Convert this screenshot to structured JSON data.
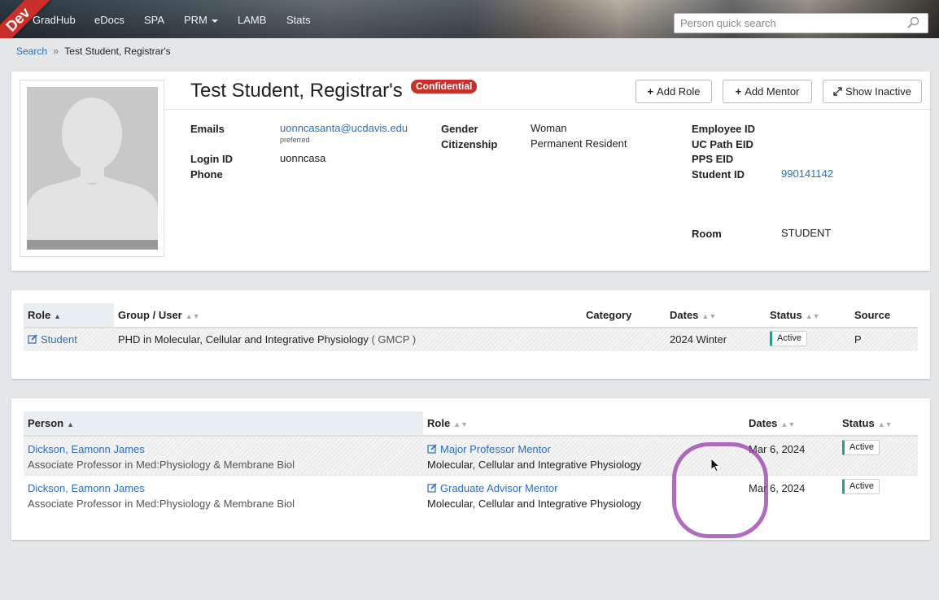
{
  "nav": {
    "ribbon": "Dev",
    "items": [
      "GradHub",
      "eDocs",
      "SPA",
      "PRM",
      "LAMB",
      "Stats"
    ],
    "search_placeholder": "Person quick search"
  },
  "breadcrumb": {
    "link": "Search",
    "sep": "»",
    "current": "Test Student, Registrar's"
  },
  "person": {
    "name": "Test Student, Registrar's",
    "badge": "Confidential",
    "buttons": {
      "add_role": "Add Role",
      "add_mentor": "Add Mentor",
      "show_inactive": "Show Inactive"
    },
    "labels": {
      "emails": "Emails",
      "login": "Login ID",
      "phone": "Phone",
      "gender": "Gender",
      "citizenship": "Citizenship",
      "employee_id": "Employee ID",
      "ucpath": "UC Path EID",
      "pps": "PPS EID",
      "student_id": "Student ID",
      "room": "Room"
    },
    "email": "uonncasanta@ucdavis.edu",
    "email_note": "preferred",
    "login": "uonncasa",
    "gender": "Woman",
    "citizenship": "Permanent Resident",
    "student_id": "990141142",
    "room": "STUDENT"
  },
  "roles_table": {
    "headers": [
      "Role",
      "Group / User",
      "Category",
      "Dates",
      "Status",
      "Source"
    ],
    "rows": [
      {
        "role": "Student",
        "group": "PHD in Molecular, Cellular and Integrative Physiology",
        "group_code": "( GMCP )",
        "category": "",
        "dates": "2024 Winter",
        "status": "Active",
        "source": "P"
      }
    ]
  },
  "mentors_table": {
    "headers": [
      "Person",
      "Role",
      "Dates",
      "Status"
    ],
    "rows": [
      {
        "name": "Dickson, Eamonn James",
        "title": "Associate Professor in Med:Physiology & Membrane Biol",
        "role": "Major Professor Mentor",
        "dept": "Molecular, Cellular and Integrative Physiology",
        "dates": "Mar 6, 2024",
        "status": "Active"
      },
      {
        "name": "Dickson, Eamonn James",
        "title": "Associate Professor in Med:Physiology & Membrane Biol",
        "role": "Graduate Advisor Mentor",
        "dept": "Molecular, Cellular and Integrative Physiology",
        "dates": "Mar 6, 2024",
        "status": "Active"
      }
    ]
  },
  "colors": {
    "link": "#2a6ebb",
    "badge": "#c9302c",
    "status_accent": "#2f9a8a",
    "annotation": "#9a3cac"
  }
}
